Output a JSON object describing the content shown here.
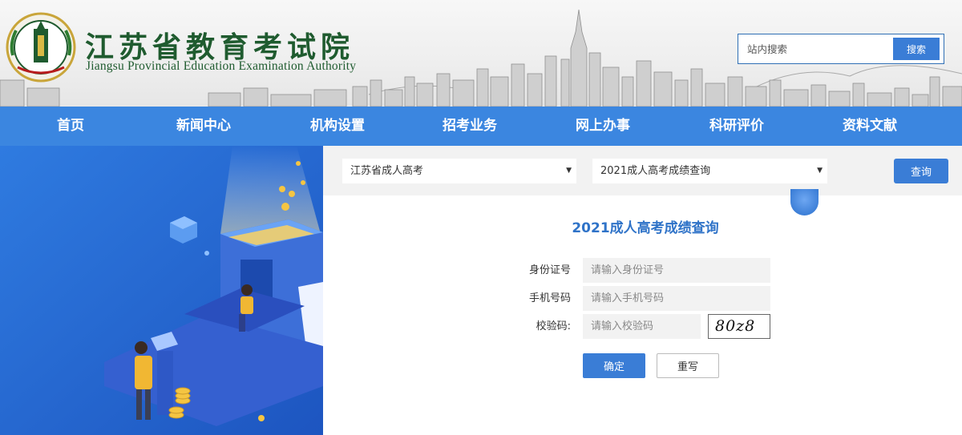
{
  "header": {
    "title_cn": "江苏省教育考试院",
    "title_en": "Jiangsu Provincial Education Examination Authority",
    "search_placeholder": "站内搜索",
    "search_button": "搜索",
    "brand_color": "#1f5b2f"
  },
  "nav": {
    "color": "#3b86e0",
    "items": [
      {
        "label": "首页"
      },
      {
        "label": "新闻中心"
      },
      {
        "label": "机构设置"
      },
      {
        "label": "招考业务"
      },
      {
        "label": "网上办事"
      },
      {
        "label": "科研评价"
      },
      {
        "label": "资料文献"
      }
    ]
  },
  "filter": {
    "category_selected": "江苏省成人高考",
    "item_selected": "2021成人高考成绩查询",
    "query_button": "查询"
  },
  "form": {
    "title": "2021成人高考成绩查询",
    "fields": [
      {
        "label": "身份证号",
        "placeholder": "请输入身份证号"
      },
      {
        "label": "手机号码",
        "placeholder": "请输入手机号码"
      },
      {
        "label": "校验码:",
        "placeholder": "请输入校验码"
      }
    ],
    "captcha_text": "80z8",
    "confirm_button": "确定",
    "reset_button": "重写"
  },
  "colors": {
    "accent": "#3a7dd6",
    "illustration_bg": "#2a6fd0"
  }
}
